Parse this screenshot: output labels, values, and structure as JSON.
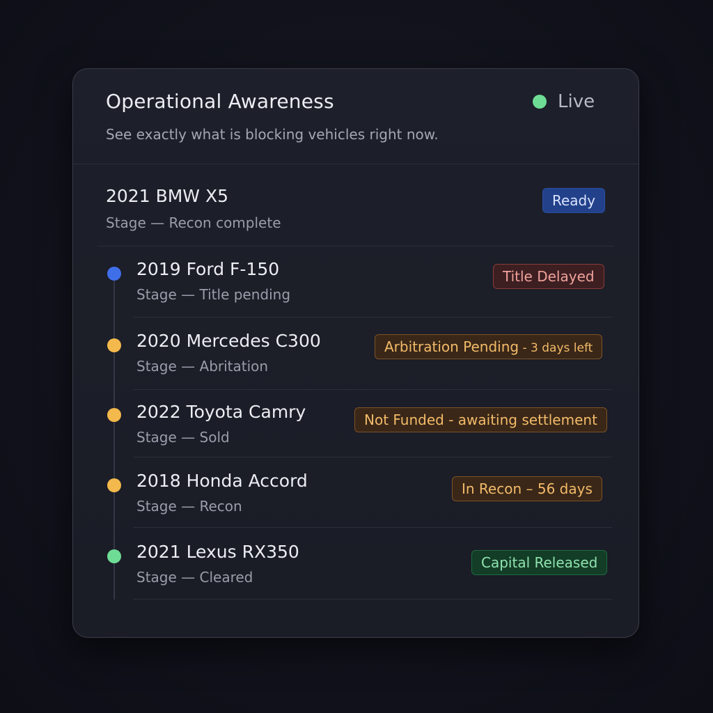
{
  "header": {
    "title": "Operational Awareness",
    "subtitle": "See exactly what is blocking vehicles right now.",
    "status_label": "Live",
    "status_color": "#6fdc95"
  },
  "top_vehicle": {
    "name": "2021 BMW X5",
    "stage": "Stage — Recon complete",
    "badge": "Ready"
  },
  "timeline": [
    {
      "name": "2019 Ford F-150",
      "stage": "Stage — Title pending",
      "badge": "Title Delayed",
      "dot_color": "#3f6fe8",
      "tone": "red"
    },
    {
      "name": "2020 Mercedes C300",
      "stage": "Stage — Abritation",
      "badge_main": "Arbitration Pending",
      "badge_detail": " - 3 days left",
      "dot_color": "#f4b94c",
      "tone": "orange"
    },
    {
      "name": "2022 Toyota Camry",
      "stage": "Stage — Sold",
      "badge": "Not Funded - awaiting settlement",
      "dot_color": "#f4b94c",
      "tone": "orange"
    },
    {
      "name": "2018 Honda Accord",
      "stage": "Stage — Recon",
      "badge": "In Recon – 56 days",
      "dot_color": "#f4b94c",
      "tone": "orange"
    },
    {
      "name": "2021 Lexus RX350",
      "stage": "Stage — Cleared",
      "badge": "Capital Released",
      "dot_color": "#6fdc95",
      "tone": "green"
    }
  ]
}
